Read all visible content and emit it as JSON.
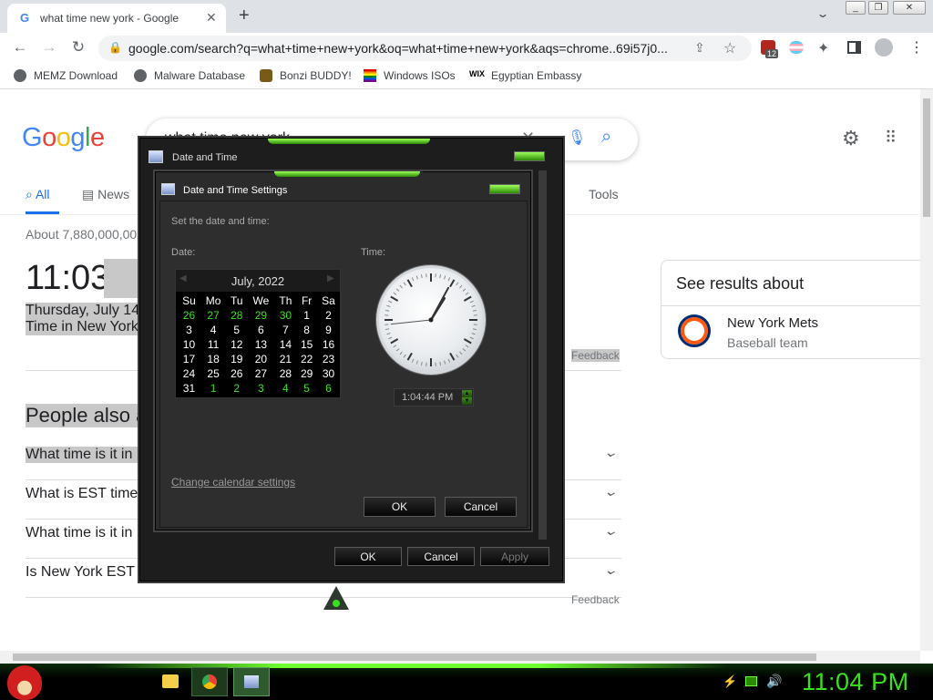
{
  "browser": {
    "tab_title": "what time new york - Google Se...",
    "url": "google.com/search?q=what+time+new+york&oq=what+time+new+york&aqs=chrome..69i57j0...",
    "extension_badge": "12",
    "bookmarks": [
      "MEMZ Download",
      "Malware Database",
      "Bonzi BUDDY!",
      "Windows ISOs",
      "Egyptian Embassy"
    ]
  },
  "google": {
    "logo": "Google",
    "query": "what time new york",
    "tabs": {
      "all": "All",
      "news": "News",
      "tools": "Tools"
    },
    "result_count": "About 7,880,000,00",
    "big_time": "11:03 P",
    "date_line": "Thursday, July 14",
    "time_in": "Time in New York",
    "feedback": "Feedback",
    "paa_title": "People also a",
    "paa": [
      "What time is it in N",
      "What is EST time",
      "What time is it in N",
      "Is New York EST"
    ],
    "see_results": "See results about",
    "entity_name": "New York Mets",
    "entity_sub": "Baseball team"
  },
  "outer_dialog": {
    "title": "Date and Time",
    "ok": "OK",
    "cancel": "Cancel",
    "apply": "Apply"
  },
  "inner_dialog": {
    "title": "Date and Time Settings",
    "instruction": "Set the date and time:",
    "date_label": "Date:",
    "time_label": "Time:",
    "month": "July, 2022",
    "weekdays": [
      "Su",
      "Mo",
      "Tu",
      "We",
      "Th",
      "Fr",
      "Sa"
    ],
    "weeks": [
      [
        {
          "d": "26",
          "o": true
        },
        {
          "d": "27",
          "o": true
        },
        {
          "d": "28",
          "o": true
        },
        {
          "d": "29",
          "o": true
        },
        {
          "d": "30",
          "o": true
        },
        {
          "d": "1",
          "o": false
        },
        {
          "d": "2",
          "o": false
        }
      ],
      [
        {
          "d": "3",
          "o": false
        },
        {
          "d": "4",
          "o": false
        },
        {
          "d": "5",
          "o": false
        },
        {
          "d": "6",
          "o": false
        },
        {
          "d": "7",
          "o": false
        },
        {
          "d": "8",
          "o": false
        },
        {
          "d": "9",
          "o": false
        }
      ],
      [
        {
          "d": "10",
          "o": false
        },
        {
          "d": "11",
          "o": false
        },
        {
          "d": "12",
          "o": false
        },
        {
          "d": "13",
          "o": false
        },
        {
          "d": "14",
          "o": false
        },
        {
          "d": "15",
          "o": false
        },
        {
          "d": "16",
          "o": false
        }
      ],
      [
        {
          "d": "17",
          "o": false
        },
        {
          "d": "18",
          "o": false
        },
        {
          "d": "19",
          "o": false
        },
        {
          "d": "20",
          "o": false
        },
        {
          "d": "21",
          "o": false
        },
        {
          "d": "22",
          "o": false
        },
        {
          "d": "23",
          "o": false
        }
      ],
      [
        {
          "d": "24",
          "o": false
        },
        {
          "d": "25",
          "o": false
        },
        {
          "d": "26",
          "o": false
        },
        {
          "d": "27",
          "o": false
        },
        {
          "d": "28",
          "o": false
        },
        {
          "d": "29",
          "o": false
        },
        {
          "d": "30",
          "o": false
        }
      ],
      [
        {
          "d": "31",
          "o": false
        },
        {
          "d": "1",
          "o": true
        },
        {
          "d": "2",
          "o": true
        },
        {
          "d": "3",
          "o": true
        },
        {
          "d": "4",
          "o": true
        },
        {
          "d": "5",
          "o": true
        },
        {
          "d": "6",
          "o": true
        }
      ]
    ],
    "time_value": "1:04:44 PM",
    "clock": {
      "hour": 1,
      "minute": 4,
      "second": 44
    },
    "change_calendar": "Change calendar settings",
    "ok": "OK",
    "cancel": "Cancel"
  },
  "taskbar": {
    "clock": "11:04 PM"
  },
  "colors": {
    "accent_green": "#39e01c",
    "google_blue": "#1a73e8"
  }
}
